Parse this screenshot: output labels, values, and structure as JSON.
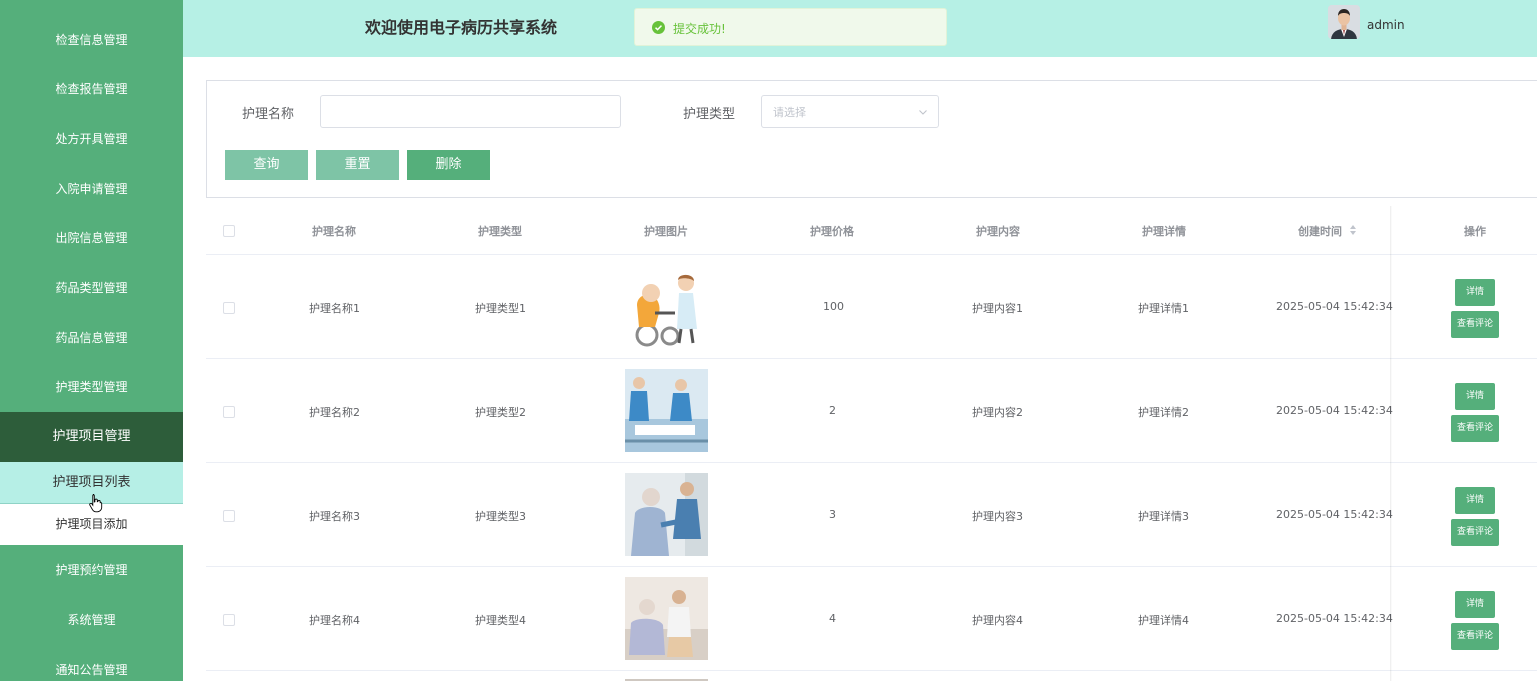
{
  "sidebar": {
    "items": [
      {
        "label": "检查信息管理"
      },
      {
        "label": "检查报告管理"
      },
      {
        "label": "处方开具管理"
      },
      {
        "label": "入院申请管理"
      },
      {
        "label": "出院信息管理"
      },
      {
        "label": "药品类型管理"
      },
      {
        "label": "药品信息管理"
      },
      {
        "label": "护理类型管理"
      },
      {
        "label": "护理项目管理"
      },
      {
        "label": "护理预约管理"
      },
      {
        "label": "系统管理"
      },
      {
        "label": "通知公告管理"
      }
    ],
    "submenu": [
      {
        "label": "护理项目列表"
      },
      {
        "label": "护理项目添加"
      }
    ]
  },
  "header": {
    "title": "欢迎使用电子病历共享系统",
    "username": "admin"
  },
  "toast": {
    "message": "提交成功!"
  },
  "search": {
    "name_label": "护理名称",
    "name_value": "",
    "type_label": "护理类型",
    "type_placeholder": "请选择",
    "query_label": "查询",
    "reset_label": "重置",
    "delete_label": "删除"
  },
  "table": {
    "headers": {
      "name": "护理名称",
      "type": "护理类型",
      "image": "护理图片",
      "price": "护理价格",
      "content": "护理内容",
      "detail": "护理详情",
      "created": "创建时间",
      "ops": "操作"
    },
    "rows": [
      {
        "name": "护理名称1",
        "type": "护理类型1",
        "price": "100",
        "content": "护理内容1",
        "detail": "护理详情1",
        "created": "2025-05-04 15:42:34"
      },
      {
        "name": "护理名称2",
        "type": "护理类型2",
        "price": "2",
        "content": "护理内容2",
        "detail": "护理详情2",
        "created": "2025-05-04 15:42:34"
      },
      {
        "name": "护理名称3",
        "type": "护理类型3",
        "price": "3",
        "content": "护理内容3",
        "detail": "护理详情3",
        "created": "2025-05-04 15:42:34"
      },
      {
        "name": "护理名称4",
        "type": "护理类型4",
        "price": "4",
        "content": "护理内容4",
        "detail": "护理详情4",
        "created": "2025-05-04 15:42:34"
      }
    ],
    "detail_btn": "详情",
    "comment_btn": "查看评论"
  },
  "colors": {
    "sidebar": "#55af7b",
    "sidebar_active": "#2d5d3a",
    "header": "#b6f0e5",
    "accent": "#55af7b"
  }
}
